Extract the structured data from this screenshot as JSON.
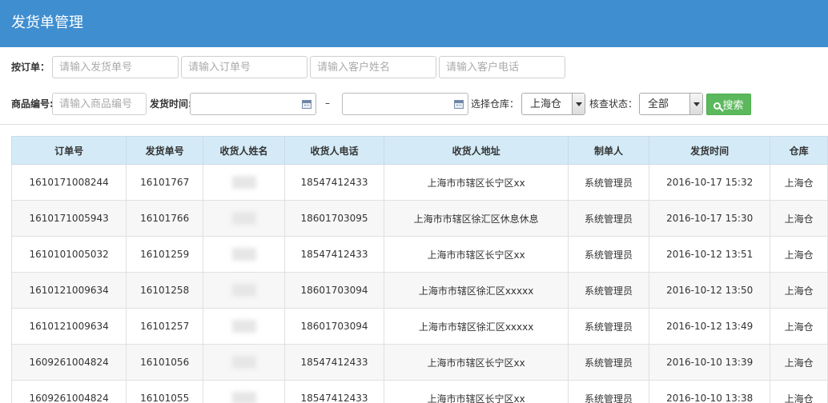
{
  "header": {
    "title": "发货单管理"
  },
  "filters": {
    "order_label": "按订单：",
    "ship_no_placeholder": "请输入发货单号",
    "order_no_placeholder": "请输入订单号",
    "customer_name_placeholder": "请输入客户姓名",
    "customer_phone_placeholder": "请输入客户电话",
    "product_label": "商品编号:",
    "product_placeholder": "请输入商品编号",
    "ship_time_label": "发货时间:",
    "range_dash": "–",
    "warehouse_label": "选择仓库：",
    "warehouse_value": "上海仓",
    "check_label": "核查状态：",
    "check_value": "全部",
    "search_label": "搜索"
  },
  "table": {
    "columns": [
      "订单号",
      "发货单号",
      "收货人姓名",
      "收货人电话",
      "收货人地址",
      "制单人",
      "发货时间",
      "仓库"
    ],
    "rows": [
      [
        "1610171008244",
        "16101767",
        "",
        "18547412433",
        "上海市市辖区长宁区xx",
        "系统管理员",
        "2016-10-17 15:32",
        "上海仓"
      ],
      [
        "1610171005943",
        "16101766",
        "",
        "18601703095",
        "上海市市辖区徐汇区休息休息",
        "系统管理员",
        "2016-10-17 15:30",
        "上海仓"
      ],
      [
        "1610101005032",
        "16101259",
        "",
        "18547412433",
        "上海市市辖区长宁区xx",
        "系统管理员",
        "2016-10-12 13:51",
        "上海仓"
      ],
      [
        "1610121009634",
        "16101258",
        "",
        "18601703094",
        "上海市市辖区徐汇区xxxxx",
        "系统管理员",
        "2016-10-12 13:50",
        "上海仓"
      ],
      [
        "1610121009634",
        "16101257",
        "",
        "18601703094",
        "上海市市辖区徐汇区xxxxx",
        "系统管理员",
        "2016-10-12 13:49",
        "上海仓"
      ],
      [
        "1609261004824",
        "16101056",
        "",
        "18547412433",
        "上海市市辖区长宁区xx",
        "系统管理员",
        "2016-10-10 13:39",
        "上海仓"
      ],
      [
        "1609261004824",
        "16101055",
        "",
        "18547412433",
        "上海市市辖区长宁区xx",
        "系统管理员",
        "2016-10-10 13:38",
        "上海仓"
      ]
    ]
  }
}
